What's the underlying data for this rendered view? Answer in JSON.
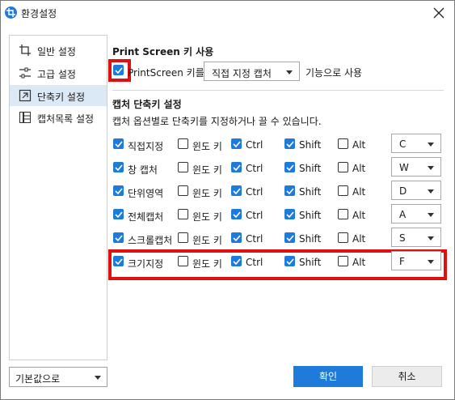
{
  "window": {
    "title": "환경설정",
    "close_icon": "close-icon",
    "app_icon": "crop-icon",
    "accent": "#1f7bd9",
    "highlight": "#e01010"
  },
  "sidebar": {
    "items": [
      {
        "label": "일반 설정",
        "icon": "crop-icon",
        "active": false
      },
      {
        "label": "고급 설정",
        "icon": "sliders-icon",
        "active": false
      },
      {
        "label": "단축키 설정",
        "icon": "shortcut-arrow-icon",
        "active": true
      },
      {
        "label": "캡처목록 설정",
        "icon": "list-grid-icon",
        "active": false
      }
    ],
    "default_select": "기본값으로"
  },
  "printscreen": {
    "title": "Print Screen 키 사용",
    "checkbox_label": "PrintScreen 키를",
    "checked": true,
    "mode_value": "직접 지정 캡처",
    "suffix": "기능으로 사용"
  },
  "shortcuts": {
    "title": "캡처 단축키 설정",
    "description": "캡처 옵션별로 단축키를 지정하거나 끌 수 있습니다.",
    "rows": [
      {
        "name": "직접지정",
        "enabled": true,
        "win_label": "윈도 키",
        "win": false,
        "ctrl_label": "Ctrl",
        "ctrl": true,
        "shift_label": "Shift",
        "shift": true,
        "alt_label": "Alt",
        "alt": false,
        "key": "C"
      },
      {
        "name": "창 캡처",
        "enabled": true,
        "win_label": "윈도 키",
        "win": false,
        "ctrl_label": "Ctrl",
        "ctrl": true,
        "shift_label": "Shift",
        "shift": true,
        "alt_label": "Alt",
        "alt": false,
        "key": "W"
      },
      {
        "name": "단위영역",
        "enabled": true,
        "win_label": "윈도 키",
        "win": false,
        "ctrl_label": "Ctrl",
        "ctrl": true,
        "shift_label": "Shift",
        "shift": true,
        "alt_label": "Alt",
        "alt": false,
        "key": "D"
      },
      {
        "name": "전체캡처",
        "enabled": true,
        "win_label": "윈도 키",
        "win": false,
        "ctrl_label": "Ctrl",
        "ctrl": true,
        "shift_label": "Shift",
        "shift": true,
        "alt_label": "Alt",
        "alt": false,
        "key": "A"
      },
      {
        "name": "스크롤캡처",
        "enabled": true,
        "win_label": "윈도 키",
        "win": false,
        "ctrl_label": "Ctrl",
        "ctrl": true,
        "shift_label": "Shift",
        "shift": true,
        "alt_label": "Alt",
        "alt": false,
        "key": "S"
      },
      {
        "name": "크기지정",
        "enabled": true,
        "win_label": "윈도 키",
        "win": false,
        "ctrl_label": "Ctrl",
        "ctrl": true,
        "shift_label": "Shift",
        "shift": true,
        "alt_label": "Alt",
        "alt": false,
        "key": "F"
      }
    ]
  },
  "buttons": {
    "ok": "확인",
    "cancel": "취소"
  }
}
